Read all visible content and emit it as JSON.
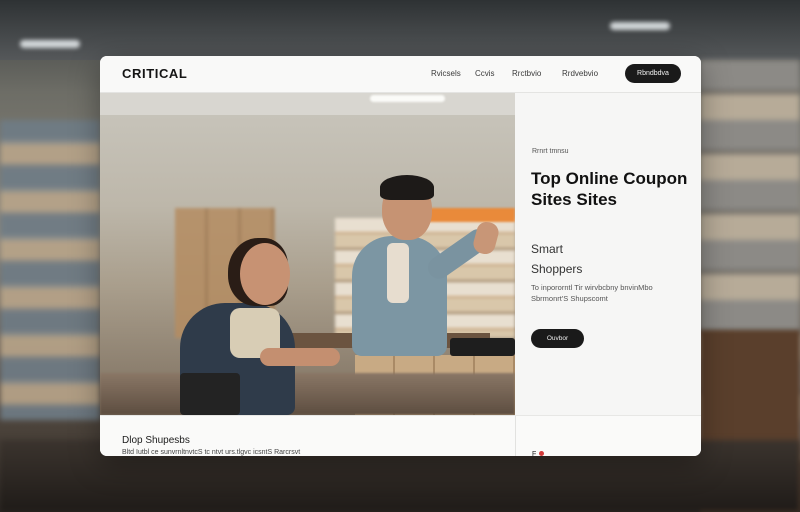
{
  "header": {
    "logo": "CRITICAL",
    "nav_links": [
      "Rvicsels",
      "Ccvis",
      "Rrctbvio",
      "Rrdvebvio"
    ],
    "nav_button": "Rbndbdva"
  },
  "hero": {
    "eyebrow": "Rrnrt tmnsu",
    "title": "Top Online Coupon Sites Sites",
    "subtitle_line1": "Smart",
    "subtitle_line2": "Shoppers",
    "description_line1": "To inpororntl Tir wirvbcbny bnvinMbo",
    "description_line2": "Sbrmonrt'S Shupscomt",
    "cta_label": "Ouvbor"
  },
  "bottom": {
    "heading": "Dlop Shupesbs",
    "text": "Bltd Iutbl ce sunvrnltnvtcS tc ntvt urs.tlgvc icsntS Rarcrsvt",
    "icons_label": "F"
  },
  "colors": {
    "accent_dark": "#1a1a1a",
    "icon_red": "#d23a3a"
  }
}
